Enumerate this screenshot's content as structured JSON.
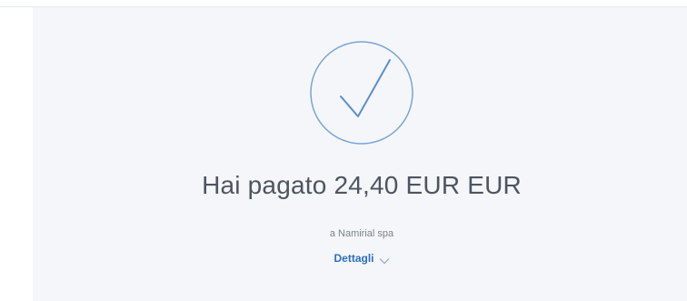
{
  "confirmation": {
    "headline": "Hai pagato 24,40 EUR EUR",
    "payee": "a Namirial spa",
    "details_label": "Dettagli"
  },
  "icons": {
    "status": "checkmark-circle-icon",
    "expand": "chevron-down-icon"
  },
  "colors": {
    "panel_background": "#f4f6f9",
    "check_stroke": "#5b8fd0",
    "link": "#2a6fc2",
    "headline_text": "#4e5460"
  }
}
